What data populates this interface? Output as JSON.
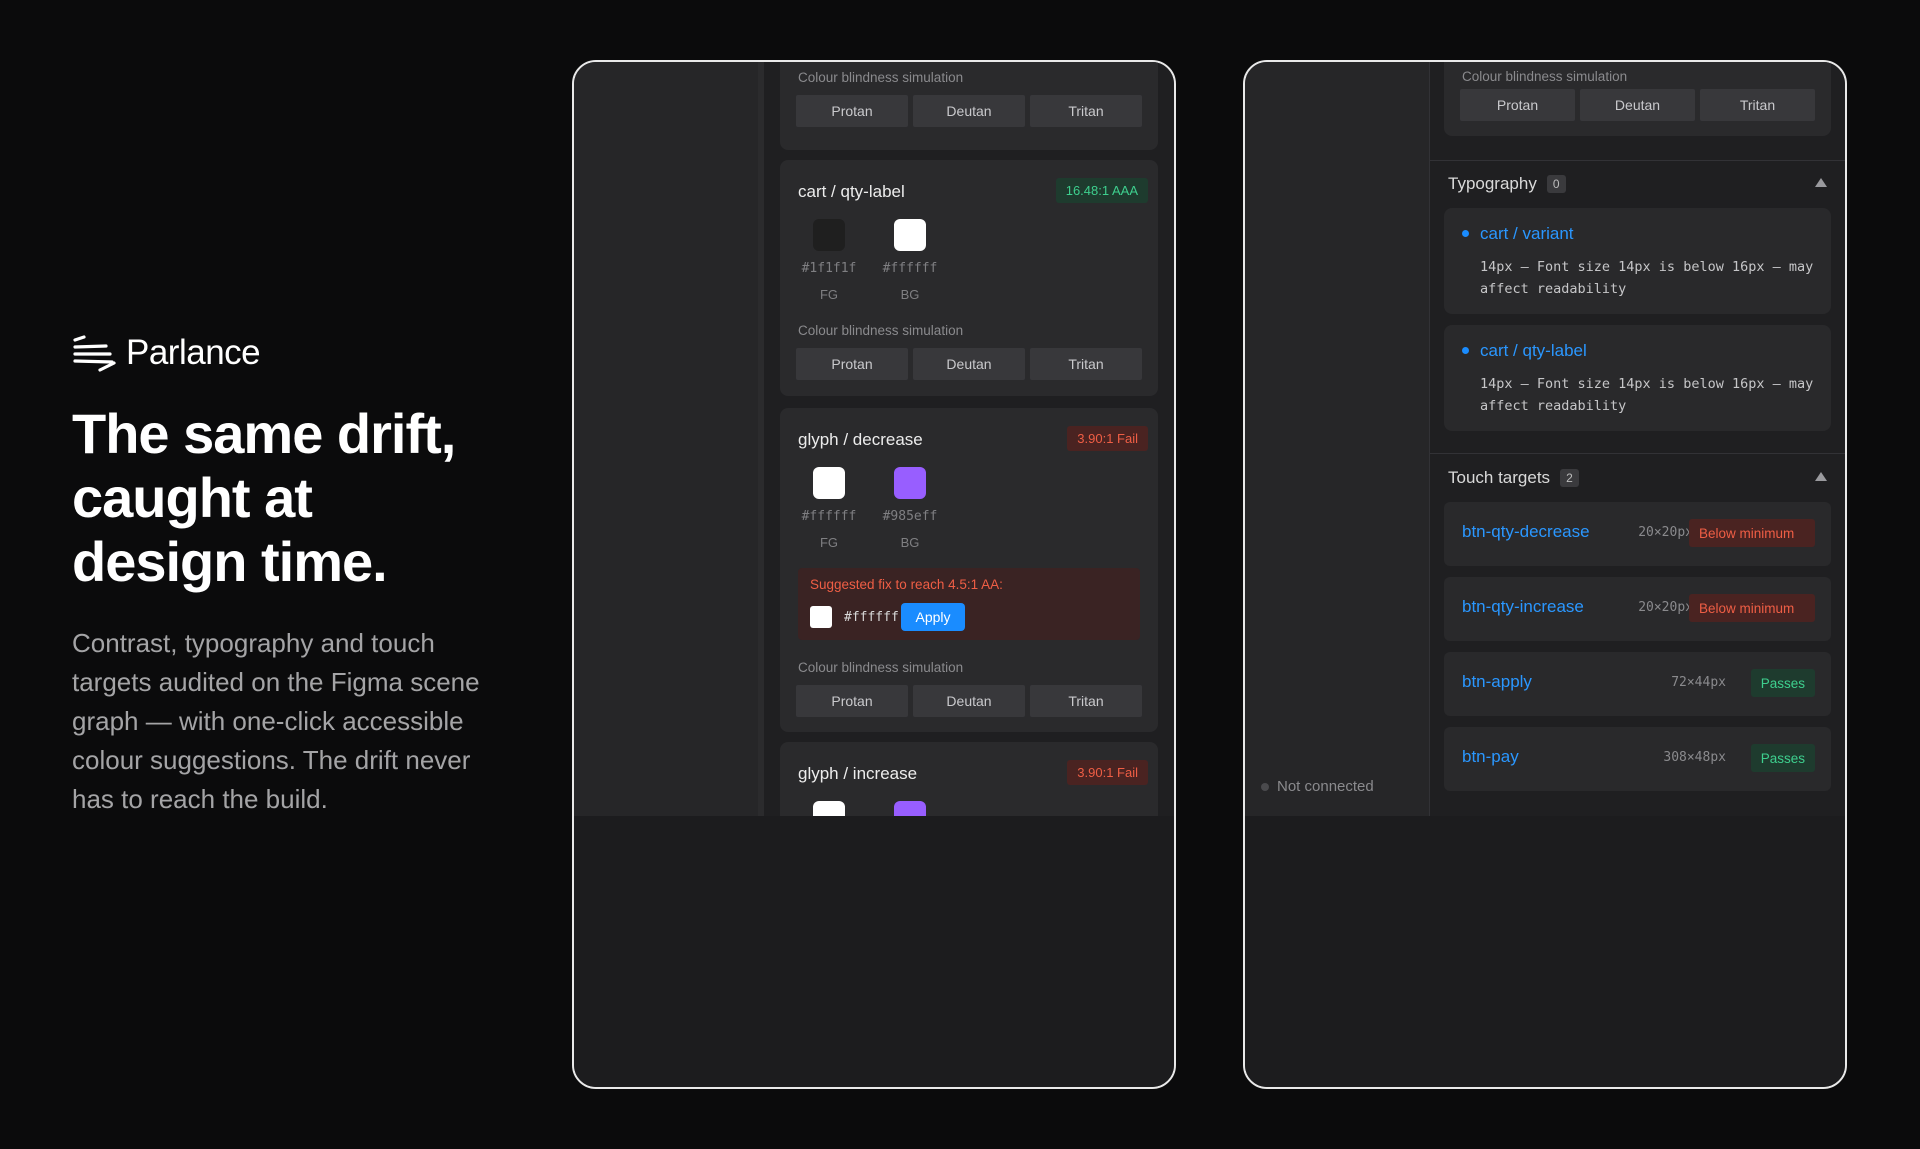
{
  "brand": {
    "name": "Parlance"
  },
  "hero": {
    "headline_lines": [
      "The same drift,",
      "caught at",
      "design time."
    ],
    "subcopy": "Contrast, typography and touch targets audited on the Figma scene graph — with one-click accessible colour suggestions. The drift never has to reach the build."
  },
  "colors": {
    "accent": "#1a8cff",
    "pass": "#3ecf8e",
    "fail": "#ef5e45",
    "swatch_violet": "#985eff"
  },
  "contrast": {
    "sim_label": "Colour blindness simulation",
    "sim_buttons": [
      "Protan",
      "Deutan",
      "Tritan"
    ],
    "fg_label": "FG",
    "bg_label": "BG",
    "cards": [
      {
        "title": "cart / qty-label",
        "badge": "16.48:1 AAA",
        "fg_hex": "#1f1f1f",
        "bg_hex": "#ffffff"
      },
      {
        "title": "glyph / decrease",
        "badge": "3.90:1 Fail",
        "fg_hex": "#ffffff",
        "bg_hex": "#985eff",
        "fix_text": "Suggested fix to reach 4.5:1 AA:",
        "fix_hex": "#ffffff",
        "apply_label": "Apply"
      },
      {
        "title": "glyph / increase",
        "badge": "3.90:1 Fail"
      }
    ]
  },
  "audit": {
    "sim_label": "Colour blindness simulation",
    "sim_buttons": [
      "Protan",
      "Deutan",
      "Tritan"
    ],
    "typography": {
      "title": "Typography",
      "count": "0",
      "items": [
        {
          "name": "cart / variant",
          "desc": "14px — Font size 14px is below 16px — may affect readability"
        },
        {
          "name": "cart / qty-label",
          "desc": "14px — Font size 14px is below 16px — may affect readability"
        }
      ]
    },
    "touch": {
      "title": "Touch targets",
      "count": "2",
      "items": [
        {
          "name": "btn-qty-decrease",
          "size": "20×20px",
          "status": "Below minimum"
        },
        {
          "name": "btn-qty-increase",
          "size": "20×20px",
          "status": "Below minimum"
        },
        {
          "name": "btn-apply",
          "size": "72×44px",
          "status": "Passes"
        },
        {
          "name": "btn-pay",
          "size": "308×48px",
          "status": "Passes"
        }
      ]
    },
    "status": "Not connected"
  }
}
